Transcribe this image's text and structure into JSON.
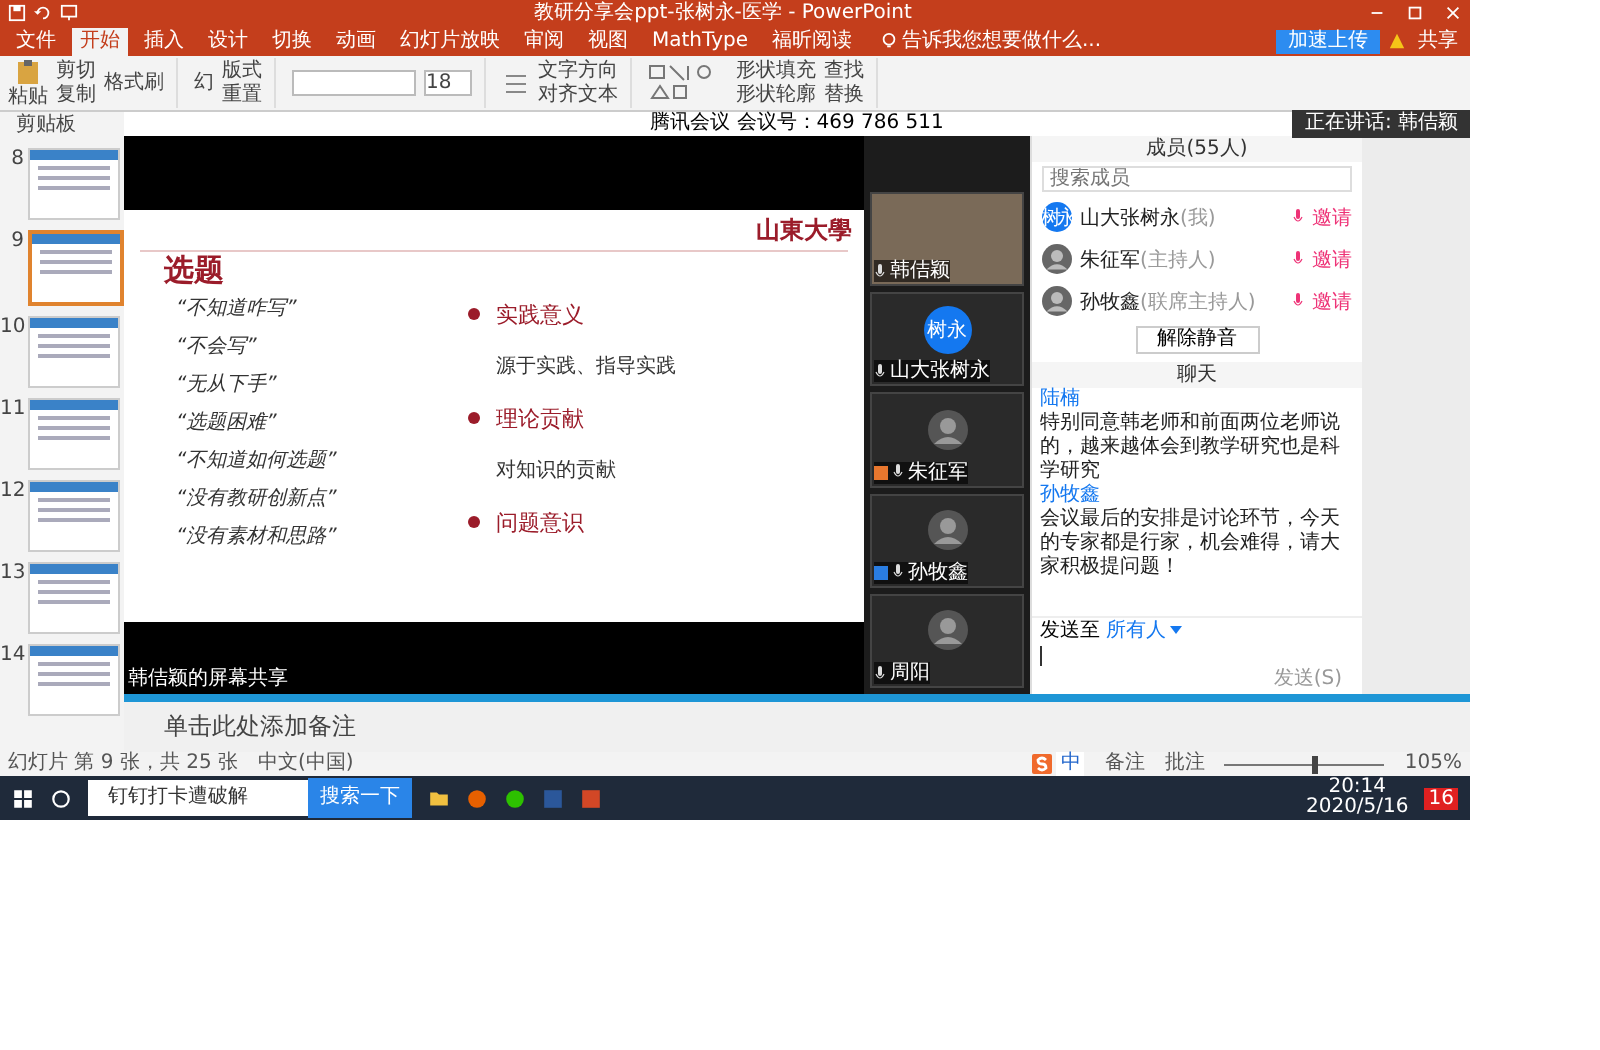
{
  "window": {
    "title": "教研分享会ppt-张树永-医学 - PowerPoint",
    "upload_button": "加速上传",
    "share_button": "共享"
  },
  "tabs": [
    {
      "label": "文件",
      "selected": false
    },
    {
      "label": "开始",
      "selected": true
    },
    {
      "label": "插入",
      "selected": false
    },
    {
      "label": "设计",
      "selected": false
    },
    {
      "label": "切换",
      "selected": false
    },
    {
      "label": "动画",
      "selected": false
    },
    {
      "label": "幻灯片放映",
      "selected": false
    },
    {
      "label": "审阅",
      "selected": false
    },
    {
      "label": "视图",
      "selected": false
    },
    {
      "label": "MathType",
      "selected": false
    },
    {
      "label": "福昕阅读",
      "selected": false
    }
  ],
  "tell_me": "告诉我您想要做什么...",
  "ribbon": {
    "paste": "粘贴",
    "cut": "剪切",
    "copy": "复制",
    "format_painter": "格式刷",
    "clipboard_group": "剪贴板",
    "new_slide": "幻",
    "layout": "版式",
    "reset": "重置",
    "font_size": "18",
    "text_direction": "文字方向",
    "align_text": "对齐文本",
    "shape_fill": "形状填充",
    "shape_outline": "形状轮廓",
    "find": "查找",
    "replace": "替换"
  },
  "thumbnails": [
    {
      "number": "8",
      "selected": false
    },
    {
      "number": "9",
      "selected": true
    },
    {
      "number": "10",
      "selected": false
    },
    {
      "number": "11",
      "selected": false
    },
    {
      "number": "12",
      "selected": false
    },
    {
      "number": "13",
      "selected": false
    },
    {
      "number": "14",
      "selected": false
    }
  ],
  "meeting": {
    "header": "腾讯会议 会议号：469 786 511",
    "speaking": "正在讲话: 韩佶颖",
    "share_label": "韩佶颖的屏幕共享"
  },
  "slide": {
    "logo": "山東大學",
    "title": "选题",
    "bullets": [
      "“不知道咋写”",
      "“不会写”",
      "“无从下手”",
      "“选题困难”",
      "“不知道如何选题”",
      "“没有教研创新点”",
      "“没有素材和思路”"
    ],
    "points": [
      {
        "kind": "heading",
        "text": "实践意义"
      },
      {
        "kind": "body",
        "text": "源于实践、指导实践"
      },
      {
        "kind": "heading",
        "text": "理论贡献"
      },
      {
        "kind": "body",
        "text": "对知识的贡献"
      },
      {
        "kind": "heading",
        "text": "问题意识"
      }
    ]
  },
  "videos": [
    {
      "kind": "camera",
      "name": "韩佶颖"
    },
    {
      "kind": "initials",
      "name": "山大张树永",
      "initials": "树永"
    },
    {
      "kind": "photo",
      "name": "朱征军",
      "color": "#e8772e"
    },
    {
      "kind": "photo",
      "name": "孙牧鑫",
      "color": "#2a7de1"
    },
    {
      "kind": "photo",
      "name": "周阳"
    }
  ],
  "members": {
    "title": "成员(55人)",
    "search": {
      "placeholder": "搜索成员"
    },
    "list": [
      {
        "name": "山大张树永",
        "role": "(我)",
        "initials": "树永",
        "action": "邀请"
      },
      {
        "name": "朱征军",
        "role": "(主持人)",
        "action": "邀请"
      },
      {
        "name": "孙牧鑫",
        "role": "(联席主持人)",
        "action": "邀请"
      }
    ],
    "unmute_button": "解除静音"
  },
  "chat": {
    "title": "聊天",
    "messages": [
      {
        "sender": "陆楠",
        "text": "特别同意韩老师和前面两位老师说的，越来越体会到教学研究也是科学研究"
      },
      {
        "sender": "孙牧鑫",
        "text": "会议最后的安排是讨论环节，今天的专家都是行家，机会难得，请大家积极提问题！"
      }
    ],
    "send_to": "发送至",
    "recipient": "所有人",
    "send_button": "发送(S)"
  },
  "notes": {
    "placeholder": "单击此处添加备注"
  },
  "status_bar": {
    "slide_info": "幻灯片 第 9 张，共 25 张",
    "language": "中文(中国)",
    "notes": "备注",
    "comments": "批注",
    "zoom": "105%",
    "zoom_slider": {
      "level": 0.55
    }
  },
  "ime": {
    "mode": "中"
  },
  "taskbar": {
    "search_text": "钉钉打卡遭破解",
    "search_button": "搜索一下",
    "time": "20:14",
    "date": "2020/5/16",
    "notification_count": "16"
  }
}
